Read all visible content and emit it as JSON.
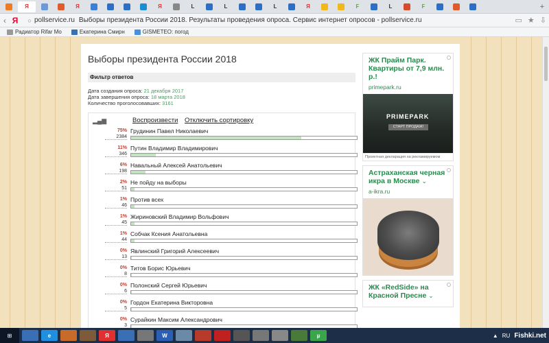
{
  "browser": {
    "tabs": [
      {
        "glyph": "",
        "color": "#ef7b22"
      },
      {
        "glyph": "Я",
        "color": "#ffffff"
      },
      {
        "glyph": "",
        "color": "#6a9bd8"
      },
      {
        "glyph": "",
        "color": "#e05a2a"
      },
      {
        "glyph": "Я",
        "color": "#e03030"
      },
      {
        "glyph": "",
        "color": "#3b7fd6"
      },
      {
        "glyph": "",
        "color": "#2c6fc4"
      },
      {
        "glyph": "",
        "color": "#2c6fc4"
      },
      {
        "glyph": "",
        "color": "#1a8fd0"
      },
      {
        "glyph": "Я",
        "color": "#e03030"
      },
      {
        "glyph": "",
        "color": "#888888"
      },
      {
        "glyph": "L",
        "color": "#333333"
      },
      {
        "glyph": "",
        "color": "#2c6fc4"
      },
      {
        "glyph": "L",
        "color": "#333333"
      },
      {
        "glyph": "",
        "color": "#2c6fc4"
      },
      {
        "glyph": "",
        "color": "#2c6fc4"
      },
      {
        "glyph": "L",
        "color": "#333333"
      },
      {
        "glyph": "",
        "color": "#2c6fc4"
      },
      {
        "glyph": "Я",
        "color": "#e03030"
      },
      {
        "glyph": "",
        "color": "#f2b81b"
      },
      {
        "glyph": "",
        "color": "#f2b81b"
      },
      {
        "glyph": "F",
        "color": "#5aad3f"
      },
      {
        "glyph": "",
        "color": "#2c6fc4"
      },
      {
        "glyph": "L",
        "color": "#333333"
      },
      {
        "glyph": "",
        "color": "#d84a2a"
      },
      {
        "glyph": "F",
        "color": "#5aad3f"
      },
      {
        "glyph": "",
        "color": "#2c6fc4"
      },
      {
        "glyph": "",
        "color": "#e05a2a"
      },
      {
        "glyph": "",
        "color": "#2c6fc4"
      }
    ],
    "yandex_logo": "Я",
    "url_domain": "pollservice.ru",
    "url_title": "Выборы президента России 2018. Результаты проведения опроса. Сервис интернет опросов - pollservice.ru",
    "bookmarks": [
      {
        "label": "Радиатор Rifar Mo",
        "color": "#999999"
      },
      {
        "label": "Екатерина Смирн",
        "color": "#3a6fb0"
      },
      {
        "label": "GISMETEO: погод",
        "color": "#4a90d9"
      }
    ]
  },
  "poll": {
    "title": "Выборы президента России 2018",
    "filter_label": "Фильтр ответов",
    "meta": [
      {
        "label": "Дата создания опроса: ",
        "value": "21 декабря 2017"
      },
      {
        "label": "Дата завершения опроса: ",
        "value": "18 марта 2018"
      },
      {
        "label": "Количество проголосовавших: ",
        "value": "3161"
      }
    ],
    "play_label": "Воспроизвести",
    "sort_label": "Отключить сортировку",
    "rows": [
      {
        "percent": "75%",
        "count": "2384",
        "name": "Грудинин Павел Николаевич",
        "share": 0.754
      },
      {
        "percent": "11%",
        "count": "346",
        "name": "Путин Владимир Владимирович",
        "share": 0.109
      },
      {
        "percent": "6%",
        "count": "198",
        "name": "Навальный Алексей Анатольевич",
        "share": 0.063
      },
      {
        "percent": "2%",
        "count": "51",
        "name": "Не пойду на выборы",
        "share": 0.016
      },
      {
        "percent": "1%",
        "count": "46",
        "name": "Против всех",
        "share": 0.015
      },
      {
        "percent": "1%",
        "count": "45",
        "name": "Жириновский Владимир Вольфович",
        "share": 0.014
      },
      {
        "percent": "1%",
        "count": "44",
        "name": "Собчак Ксения Анатольевна",
        "share": 0.014
      },
      {
        "percent": "0%",
        "count": "13",
        "name": "Явлинский Григорий Алексеевич",
        "share": 0.004
      },
      {
        "percent": "0%",
        "count": "8",
        "name": "Титов Борис Юрьевич",
        "share": 0.003
      },
      {
        "percent": "0%",
        "count": "6",
        "name": "Полонский Сергей Юрьевич",
        "share": 0.002
      },
      {
        "percent": "0%",
        "count": "5",
        "name": "Гордон Екатерина Викторовна",
        "share": 0.002
      },
      {
        "percent": "0%",
        "count": "3",
        "name": "Сурайкин Максим Александрович",
        "share": 0.001
      }
    ]
  },
  "ads": [
    {
      "title": "ЖК Прайм Парк. Квартиры от 7,9 млн. р.!",
      "domain": "primepark.ru",
      "brand": "PRIMEPARK",
      "button": "СТАРТ ПРОДАЖ!",
      "note": "Проектная декларация на рекламируемом"
    },
    {
      "title": "Астраханская черная икра в Москве",
      "domain": "a-ikra.ru"
    },
    {
      "title": "ЖК «RedSide» на Красной Пресне"
    }
  ],
  "taskbar": {
    "items": [
      {
        "glyph": "",
        "color": "#3b6fb5"
      },
      {
        "glyph": "e",
        "color": "#1f8fe0"
      },
      {
        "glyph": "",
        "color": "#c86a2a"
      },
      {
        "glyph": "",
        "color": "#7d5a3a"
      },
      {
        "glyph": "Я",
        "color": "#e03030"
      },
      {
        "glyph": "",
        "color": "#3b6fb5"
      },
      {
        "glyph": "",
        "color": "#777777"
      },
      {
        "glyph": "W",
        "color": "#2b5fb4"
      },
      {
        "glyph": "",
        "color": "#6a8aa8"
      },
      {
        "glyph": "",
        "color": "#b83a2a"
      },
      {
        "glyph": "",
        "color": "#c02020"
      },
      {
        "glyph": "",
        "color": "#555555"
      },
      {
        "glyph": "",
        "color": "#777777"
      },
      {
        "glyph": "",
        "color": "#888888"
      },
      {
        "glyph": "",
        "color": "#4a7a3a"
      },
      {
        "glyph": "µ",
        "color": "#3aa54a"
      }
    ],
    "lang": "RU",
    "watermark": "Fishki.net"
  }
}
